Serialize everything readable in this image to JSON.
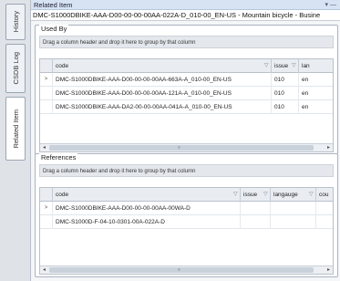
{
  "tabs": [
    {
      "label": "History"
    },
    {
      "label": "CSDB Log"
    },
    {
      "label": "Related Item"
    }
  ],
  "panel": {
    "title": "Related Item",
    "controls": "▾ —",
    "item_name": "DMC-S1000DBIKE-AAA-D00-00-00-00AA-022A-D_010-00_EN-US - Mountain bicycle - Busine"
  },
  "used_by": {
    "label": "Used By",
    "drag_hint": "Drag a column header and drop it here to group by that column",
    "columns": [
      "code",
      "issue",
      "lan"
    ],
    "rows": [
      {
        "selector": ">",
        "code": "DMC-S1000DBIKE-AAA-D00-00-00-00AA-663A-A_010-00_EN-US",
        "issue": "010",
        "lang": "en"
      },
      {
        "selector": "",
        "code": "DMC-S1000DBIKE-AAA-D00-00-00-00AA-121A-A_010-00_EN-US",
        "issue": "010",
        "lang": "en"
      },
      {
        "selector": "",
        "code": "DMC-S1000DBIKE-AAA-DA2-00-00-00AA-041A-A_010-00_EN-US",
        "issue": "010",
        "lang": "en"
      }
    ]
  },
  "references": {
    "label": "References",
    "drag_hint": "Drag a column header and drop it here to group by that column",
    "columns": [
      "code",
      "issue",
      "langauge",
      "cou"
    ],
    "rows": [
      {
        "selector": ">",
        "code": "DMC-S1000DBIKE-AAA-D00-00-00-00AA-00WA-D",
        "issue": "",
        "lang": "",
        "cou": ""
      },
      {
        "selector": "",
        "code": "DMC-S1000D-F-04-10-0301-00A-022A-D",
        "issue": "",
        "lang": "",
        "cou": ""
      }
    ]
  },
  "scroll": {
    "left_arrow": "◂",
    "right_arrow": "▸",
    "grip": "≡"
  }
}
